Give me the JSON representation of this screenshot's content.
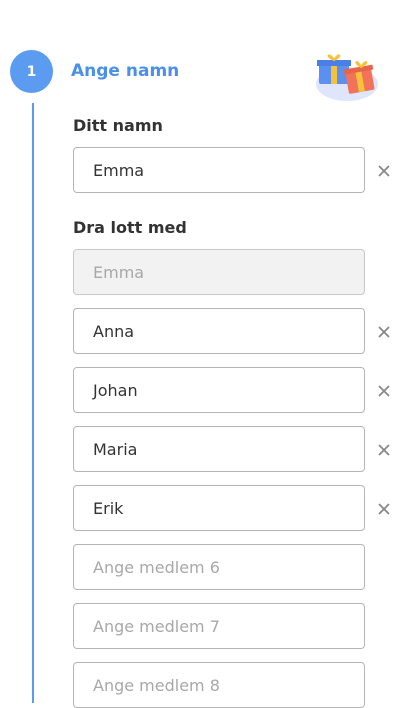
{
  "step": {
    "number": "1",
    "title": "Ange namn"
  },
  "your_name": {
    "label": "Ditt namn",
    "value": "Emma"
  },
  "draw_with": {
    "label": "Dra lott med",
    "self_value": "Emma",
    "members": [
      "Anna",
      "Johan",
      "Maria",
      "Erik"
    ],
    "placeholders": [
      "Ange medlem 6",
      "Ange medlem 7",
      "Ange medlem 8"
    ]
  },
  "icons": {
    "remove": "close-icon",
    "illustration": "gift-boxes-icon"
  },
  "colors": {
    "accent": "#5b9bf0",
    "title": "#4a8fe8"
  }
}
